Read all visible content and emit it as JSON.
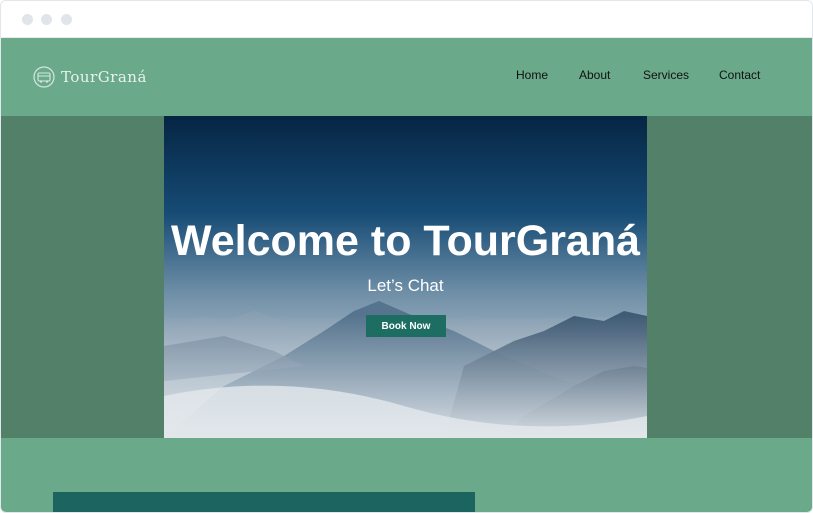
{
  "browser": {
    "window_controls": [
      "close",
      "minimize",
      "maximize"
    ]
  },
  "header": {
    "logo_text": "TourGraná",
    "logo_icon": "tour-bus-icon",
    "nav": [
      {
        "label": "Home"
      },
      {
        "label": "About"
      },
      {
        "label": "Services"
      },
      {
        "label": "Contact"
      }
    ]
  },
  "hero": {
    "title": "Welcome to TourGraná",
    "subtitle": "Let’s Chat",
    "button_label": "Book Now",
    "image": "misty-mountains-image"
  },
  "colors": {
    "page_bg": "#6aa98a",
    "hero_band": "#528068",
    "button": "#1d6d63",
    "section_block": "#1c6460"
  }
}
